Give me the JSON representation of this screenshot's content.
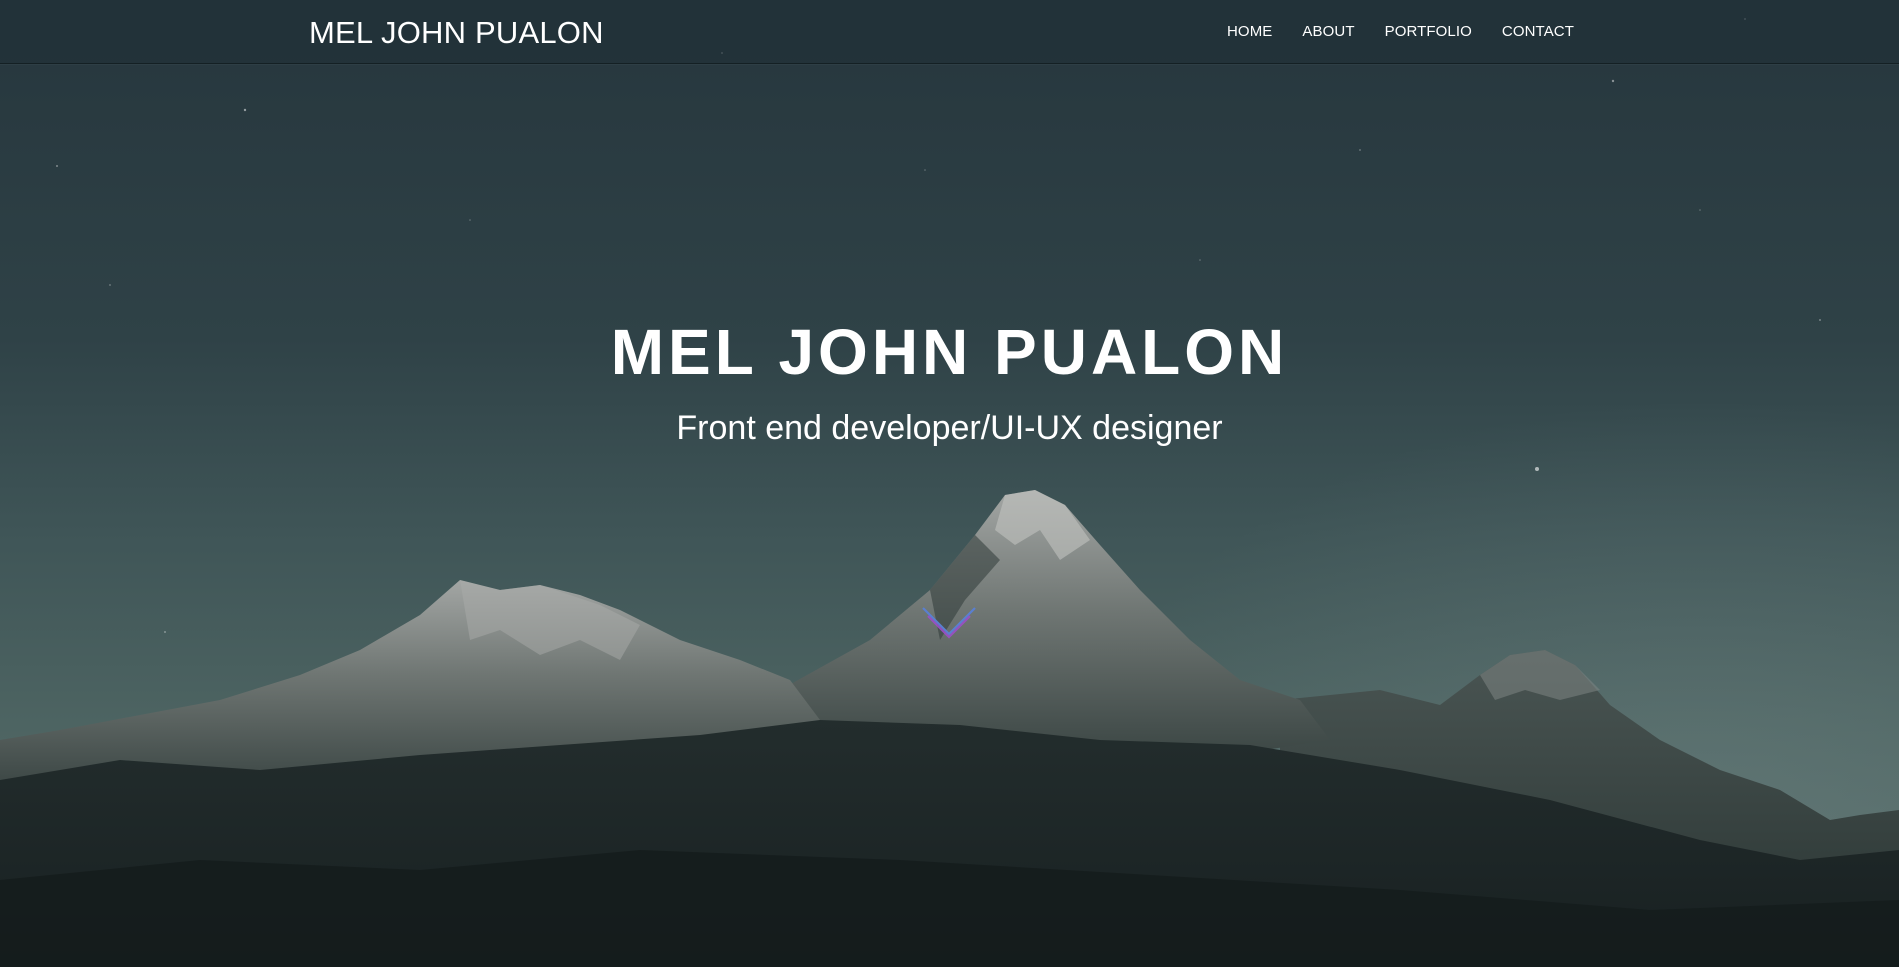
{
  "navbar": {
    "brand": "MEL JOHN PUALON",
    "links": [
      "HOME",
      "ABOUT",
      "PORTFOLIO",
      "CONTACT"
    ]
  },
  "hero": {
    "title": "MEL JOHN PUALON",
    "subtitle": "Front end developer/UI-UX designer",
    "scroll_icon": "chevron-down-icon"
  },
  "colors": {
    "text": "#ffffff",
    "sky_top": "#26363d",
    "sky_bottom": "#5b716e",
    "chevron_blue": "#5a7fd0",
    "chevron_purple": "#9a4fc8"
  }
}
